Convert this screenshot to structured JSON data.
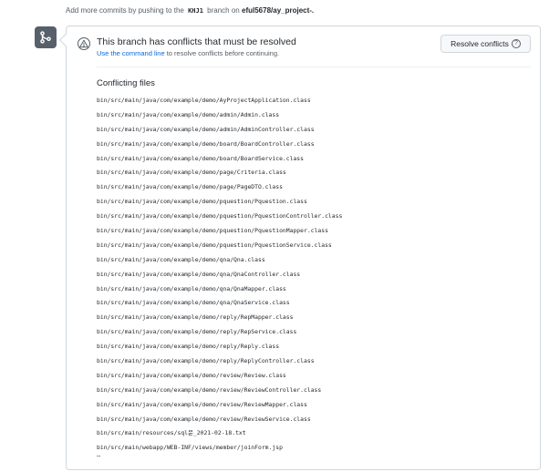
{
  "top_note": {
    "prefix": "Add more commits by pushing to the",
    "branch": "KHJ1",
    "middle": "branch on",
    "repo": "eful5678/ay_project-."
  },
  "icons": {
    "merge": "git-merge-icon",
    "warning": "alert-icon",
    "help": "question-icon"
  },
  "conflict": {
    "title": "This branch has conflicts that must be resolved",
    "subtitle_link": "Use the command line",
    "subtitle_rest": " to resolve conflicts before continuing.",
    "resolve_button": "Resolve conflicts",
    "help_glyph": "?"
  },
  "files": {
    "heading": "Conflicting files",
    "items": [
      "bin/src/main/java/com/example/demo/AyProjectApplication.class",
      "bin/src/main/java/com/example/demo/admin/Admin.class",
      "bin/src/main/java/com/example/demo/admin/AdminController.class",
      "bin/src/main/java/com/example/demo/board/BoardController.class",
      "bin/src/main/java/com/example/demo/board/BoardService.class",
      "bin/src/main/java/com/example/demo/page/Criteria.class",
      "bin/src/main/java/com/example/demo/page/PageDTO.class",
      "bin/src/main/java/com/example/demo/pquestion/Pquestion.class",
      "bin/src/main/java/com/example/demo/pquestion/PquestionController.class",
      "bin/src/main/java/com/example/demo/pquestion/PquestionMapper.class",
      "bin/src/main/java/com/example/demo/pquestion/PquestionService.class",
      "bin/src/main/java/com/example/demo/qna/Qna.class",
      "bin/src/main/java/com/example/demo/qna/QnaController.class",
      "bin/src/main/java/com/example/demo/qna/QnaMapper.class",
      "bin/src/main/java/com/example/demo/qna/QnaService.class",
      "bin/src/main/java/com/example/demo/reply/RepMapper.class",
      "bin/src/main/java/com/example/demo/reply/RepService.class",
      "bin/src/main/java/com/example/demo/reply/Reply.class",
      "bin/src/main/java/com/example/demo/reply/ReplyController.class",
      "bin/src/main/java/com/example/demo/review/Review.class",
      "bin/src/main/java/com/example/demo/review/ReviewController.class",
      "bin/src/main/java/com/example/demo/review/ReviewMapper.class",
      "bin/src/main/java/com/example/demo/review/ReviewService.class",
      "bin/src/main/resources/sql문_2021-02-18.txt",
      "bin/src/main/webapp/WEB-INF/views/member/joinForm.jsp"
    ],
    "more": "…"
  },
  "colors": {
    "link": "#0969da",
    "muted": "#57606a",
    "border": "#d0d7de"
  }
}
